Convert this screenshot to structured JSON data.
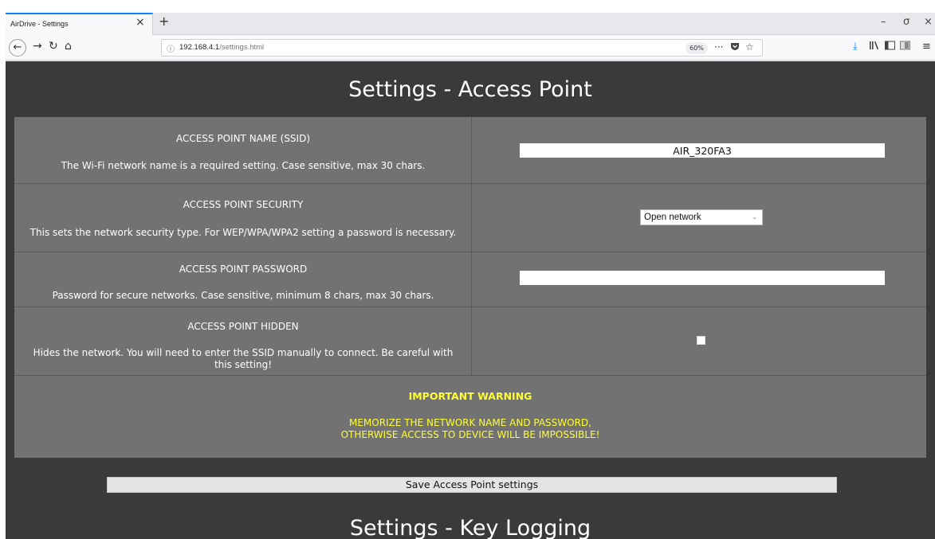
{
  "browser": {
    "tab_title": "AirDrive - Settings",
    "tab_close": "×",
    "new_tab": "+",
    "url_host": "192.168.4.1",
    "url_path": "/settings.html",
    "zoom": "60%",
    "page_actions": "···",
    "window_controls": [
      "–",
      "σ",
      "×"
    ]
  },
  "page": {
    "title": "Settings - Access Point",
    "next_section_title": "Settings - Key Logging",
    "rows": [
      {
        "label": "ACCESS POINT NAME (SSID)",
        "description": "The Wi-Fi network name is a required setting. Case sensitive, max 30 chars.",
        "value": "AIR_320FA3"
      },
      {
        "label": "ACCESS POINT SECURITY",
        "description": "This sets the network security type. For WEP/WPA/WPA2 setting a password is necessary.",
        "selected": "Open network"
      },
      {
        "label": "ACCESS POINT PASSWORD",
        "description": "Password for secure networks. Case sensitive, minimum 8 chars, max 30 chars.",
        "value": ""
      },
      {
        "label": "ACCESS POINT HIDDEN",
        "description": "Hides the network. You will need to enter the SSID manually to connect. Be careful with this setting!",
        "checked": false
      }
    ],
    "warning": {
      "title": "IMPORTANT WARNING",
      "line1": "MEMORIZE THE NETWORK NAME AND PASSWORD,",
      "line2": "OTHERWISE ACCESS TO DEVICE WILL BE IMPOSSIBLE!"
    },
    "save_button": "Save Access Point settings"
  },
  "colors": {
    "page_bg": "#3a3a3a",
    "row_bg": "#727272",
    "warning_text": "#ffff33"
  }
}
